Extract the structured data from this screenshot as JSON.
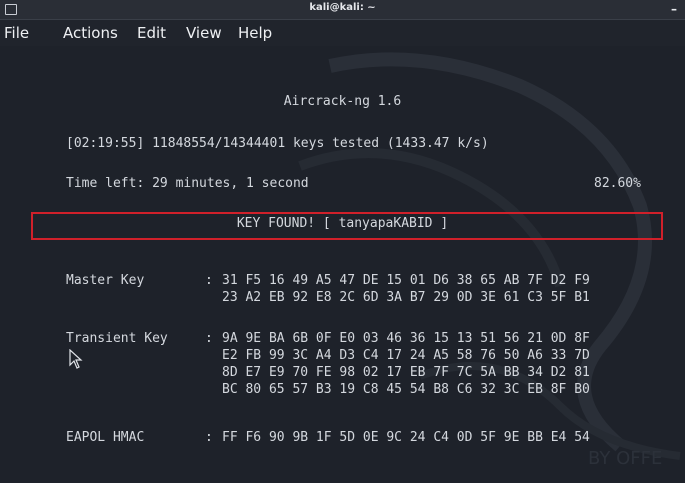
{
  "window": {
    "title": "kali@kali: ~",
    "minimize_glyph": "–"
  },
  "menu": {
    "items": [
      "File",
      "Actions",
      "Edit",
      "View",
      "Help"
    ]
  },
  "terminal": {
    "header": "Aircrack-ng 1.6",
    "progress_line": "[02:19:55] 11848554/14344401 keys tested (1433.47 k/s)",
    "time_left": "Time left: 29 minutes, 1 second",
    "percent": "82.60%",
    "key_found": "KEY FOUND! [ tanyapaKABID ]",
    "master_key": {
      "label": "Master Key",
      "sep": ":",
      "rows": [
        "31 F5 16 49 A5 47 DE 15 01 D6 38 65 AB 7F D2 F9",
        "23 A2 EB 92 E8 2C 6D 3A B7 29 0D 3E 61 C3 5F B1"
      ]
    },
    "transient_key": {
      "label": "Transient Key",
      "sep": ":",
      "rows": [
        "9A 9E BA 6B 0F E0 03 46 36 15 13 51 56 21 0D 8F",
        "E2 FB 99 3C A4 D3 C4 17 24 A5 58 76 50 A6 33 7D",
        "8D E7 E9 70 FE 98 02 17 EB 7F 7C 5A BB 34 D2 81",
        "BC 80 65 57 B3 19 C8 45 54 B8 C6 32 3C EB 8F B0"
      ]
    },
    "eapol_hmac": {
      "label": "EAPOL HMAC",
      "sep": ":",
      "rows": [
        "FF F6 90 9B 1F 5D 0E 9C 24 C4 0D 5F 9E BB E4 54"
      ]
    },
    "watermark": "BY OFFE"
  },
  "colors": {
    "terminal_bg": "#1e222a",
    "text": "#d4d8de",
    "highlight_box": "#d0202a"
  }
}
